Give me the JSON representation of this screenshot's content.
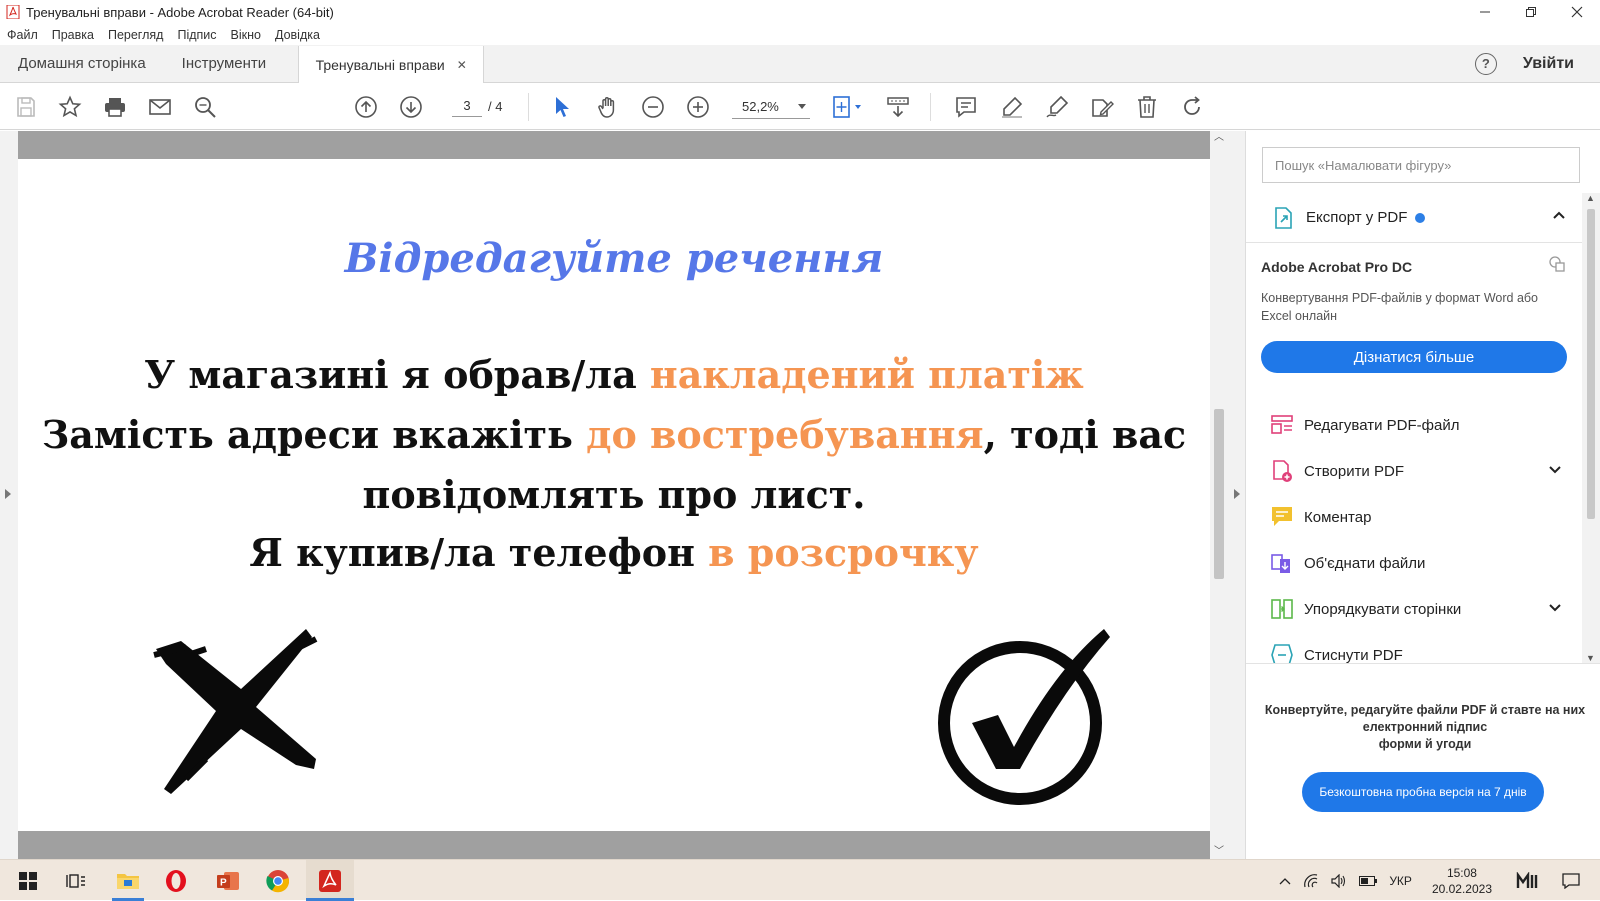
{
  "window": {
    "title": "Тренувальні вправи - Adobe Acrobat Reader (64-bit)"
  },
  "menu": [
    "Файл",
    "Правка",
    "Перегляд",
    "Підпис",
    "Вікно",
    "Довідка"
  ],
  "tabs": {
    "home": "Домашня сторінка",
    "tools": "Інструменти",
    "document": "Тренувальні вправи",
    "signin": "Увійти"
  },
  "toolbar": {
    "page_current": "3",
    "page_total": "/ 4",
    "zoom": "52,2%"
  },
  "document": {
    "title": "Відредагуйте речення",
    "line1": {
      "text": "У магазині я обрав/ла ",
      "highlight": "накладений платіж"
    },
    "line2": {
      "text": "Замість адреси вкажіть ",
      "highlight": "до востребування",
      "tail": ", тоді вас"
    },
    "line3": {
      "text": "повідомлять про лист."
    },
    "line4": {
      "text": "Я купив/ла телефон ",
      "highlight": "в розсрочку"
    }
  },
  "pane": {
    "search_placeholder": "Пошук «Намалювати фігуру»",
    "export": {
      "label": "Експорт у PDF",
      "product": "Adobe Acrobat Pro DC",
      "description": "Конвертування PDF-файлів у формат Word або Excel онлайн",
      "button": "Дізнатися більше"
    },
    "tools": [
      {
        "label": "Редагувати PDF-файл",
        "icon": "edit-pdf-icon",
        "color": "#e0407a"
      },
      {
        "label": "Створити PDF",
        "icon": "create-pdf-icon",
        "color": "#e0407a"
      },
      {
        "label": "Коментар",
        "icon": "comment-icon",
        "color": "#f2c12e"
      },
      {
        "label": "Об'єднати файли",
        "icon": "combine-files-icon",
        "color": "#7a5ce6"
      },
      {
        "label": "Упорядкувати сторінки",
        "icon": "organize-pages-icon",
        "color": "#5bb84a"
      },
      {
        "label": "Стиснути PDF",
        "icon": "compress-pdf-icon",
        "color": "#2aa3b5"
      }
    ],
    "promo": "Конвертуйте, редагуйте файли PDF й ставте на них\nелектронний підпис\nформи й угоди",
    "trial_button": "Безкоштовна пробна версія на 7 днів"
  },
  "taskbar": {
    "language": "УКР",
    "time": "15:08",
    "date": "20.02.2023"
  },
  "colors": {
    "accent": "#1f78e8",
    "highlight": "#f59552",
    "title": "#5677e8"
  }
}
